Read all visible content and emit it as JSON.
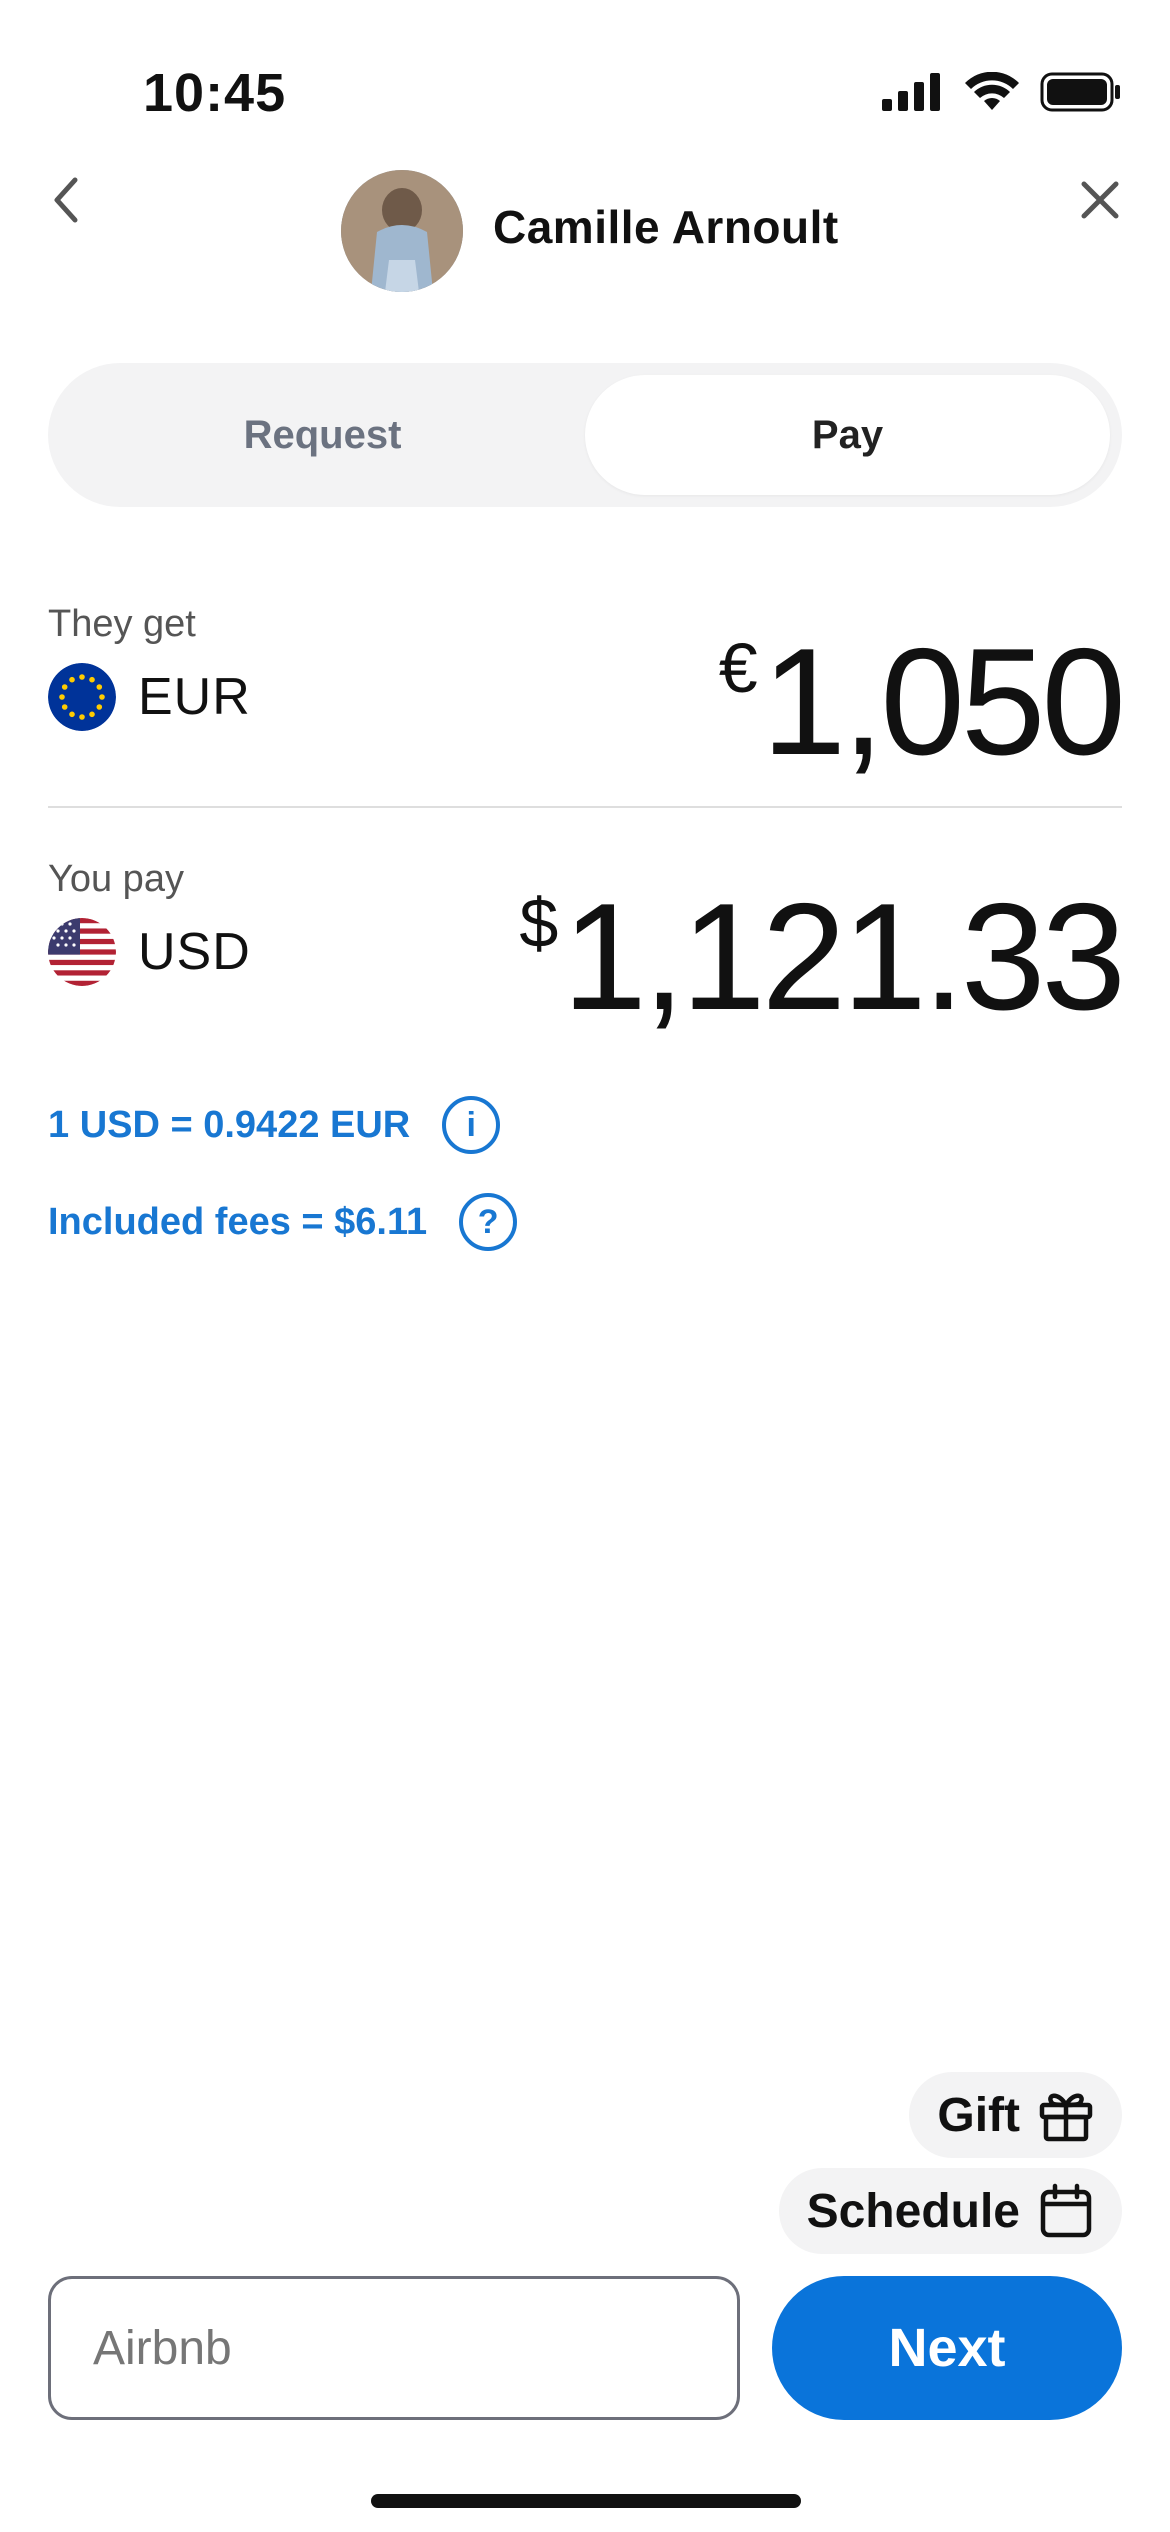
{
  "status_bar": {
    "time": "10:45",
    "icons": [
      "signal-icon",
      "wifi-icon",
      "battery-icon"
    ]
  },
  "header": {
    "back_icon": "chevron-left-icon",
    "close_icon": "close-icon",
    "contact_name": "Camille Arnoult"
  },
  "segment": {
    "request_label": "Request",
    "pay_label": "Pay",
    "selected": "Pay"
  },
  "receive": {
    "label": "They get",
    "currency_code": "EUR",
    "symbol": "€",
    "amount": "1,050"
  },
  "send": {
    "label": "You pay",
    "currency_code": "USD",
    "symbol": "$",
    "amount": "1,121.33"
  },
  "rate": {
    "text": "1 USD = 0.9422 EUR",
    "icon_glyph": "i"
  },
  "fees": {
    "text": "Included fees = $6.11",
    "icon_glyph": "?"
  },
  "chips": {
    "gift_label": "Gift",
    "schedule_label": "Schedule"
  },
  "memo": {
    "placeholder": "Airbnb"
  },
  "next_label": "Next",
  "colors": {
    "accent": "#0a74da",
    "link": "#1877d2",
    "segment_bg": "#f3f3f4",
    "eu_blue": "#003399",
    "eu_star": "#ffcc00",
    "us_red": "#b22234",
    "us_blue": "#3c3b6e"
  }
}
